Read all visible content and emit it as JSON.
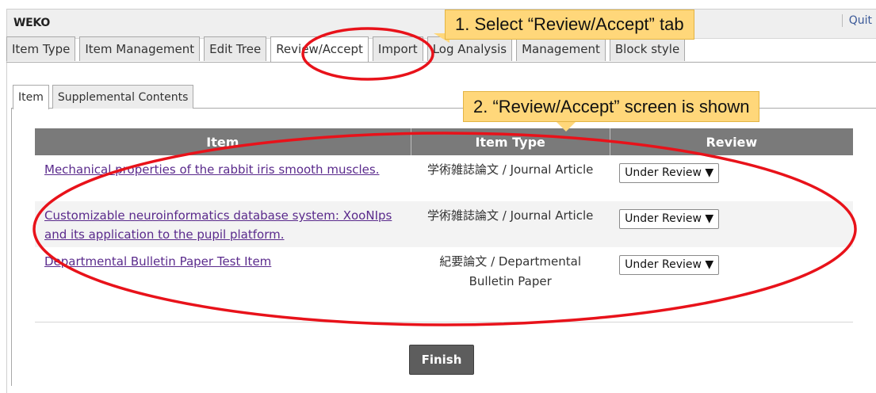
{
  "app": {
    "title": "WEKO",
    "quit_label": "Quit"
  },
  "main_tabs": [
    {
      "label": "Item Type"
    },
    {
      "label": "Item Management"
    },
    {
      "label": "Edit Tree"
    },
    {
      "label": "Review/Accept",
      "active": true
    },
    {
      "label": "Import"
    },
    {
      "label": "Log Analysis"
    },
    {
      "label": "Management"
    },
    {
      "label": "Block style"
    }
  ],
  "sub_tabs": [
    {
      "label": "Item",
      "active": true
    },
    {
      "label": "Supplemental Contents"
    }
  ],
  "table": {
    "headers": {
      "item": "Item",
      "item_type": "Item Type",
      "review": "Review"
    },
    "rows": [
      {
        "item": "Mechanical properties of the rabbit iris smooth muscles.",
        "item_type": "学術雑誌論文 / Journal Article",
        "review": "Under Review ▼"
      },
      {
        "item": "Customizable neuroinformatics database system: XooNIps and its application to the pupil platform.",
        "item_type": "学術雑誌論文 / Journal Article",
        "review": "Under Review ▼"
      },
      {
        "item": "Departmental Bulletin Paper Test Item",
        "item_type": "紀要論文 / Departmental Bulletin Paper",
        "review": "Under Review ▼"
      }
    ]
  },
  "finish_label": "Finish",
  "annotations": {
    "step1": "1. Select “Review/Accept” tab",
    "step2": "2. “Review/Accept” screen is shown"
  },
  "colors": {
    "highlight": "#e8121a",
    "callout": "#ffd77a",
    "header": "#7a7a7a"
  }
}
